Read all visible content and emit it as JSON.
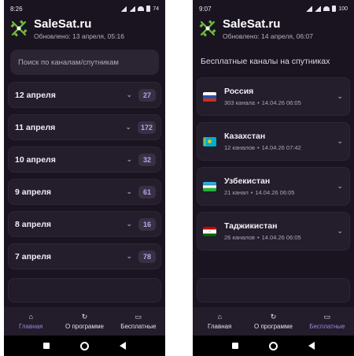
{
  "left_screen": {
    "status": {
      "time": "8:26",
      "battery": "74"
    },
    "app_title": "SaleSat.ru",
    "updated": "Обновлено: 13 апреля, 05:16",
    "search_placeholder": "Поиск по каналам/спутникам",
    "days": [
      {
        "label": "12 апреля",
        "count": "27"
      },
      {
        "label": "11 апреля",
        "count": "172"
      },
      {
        "label": "10 апреля",
        "count": "32"
      },
      {
        "label": "9 апреля",
        "count": "61"
      },
      {
        "label": "8 апреля",
        "count": "16"
      },
      {
        "label": "7 апреля",
        "count": "78"
      }
    ]
  },
  "right_screen": {
    "status": {
      "time": "9:07",
      "battery": "100"
    },
    "app_title": "SaleSat.ru",
    "updated": "Обновлено: 14 апреля, 06:07",
    "section_title": "Бесплатные каналы на спутниках",
    "countries": [
      {
        "name": "Россия",
        "channels": "303 канала",
        "updated": "14.04.26 06:05",
        "flag": "russia-flag"
      },
      {
        "name": "Казахстан",
        "channels": "12 каналов",
        "updated": "14.04.26 07:42",
        "flag": "kazakhstan-flag"
      },
      {
        "name": "Узбекистан",
        "channels": "21 канал",
        "updated": "14.04.26 06:05",
        "flag": "uzbekistan-flag"
      },
      {
        "name": "Таджикистан",
        "channels": "26 каналов",
        "updated": "14.04.26 06:05",
        "flag": "tajikistan-flag"
      }
    ]
  },
  "nav": {
    "home": "Главная",
    "about": "О программе",
    "free": "Бесплатные"
  },
  "icons": {
    "home": "home-icon",
    "about": "refresh-icon",
    "free": "tv-icon",
    "logo": "satellite-icon"
  },
  "colors": {
    "background": "#1a1420",
    "card": "#241d2b",
    "accent": "#9f86d8",
    "badge_bg": "#3a3045"
  }
}
